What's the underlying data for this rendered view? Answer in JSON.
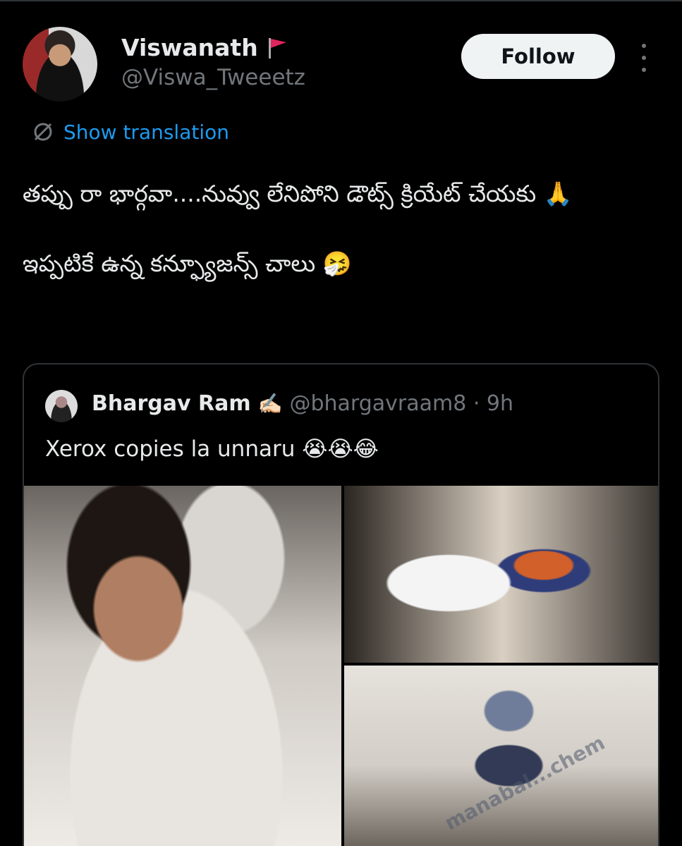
{
  "author": {
    "display_name": "Viswanath",
    "handle": "@Viswa_Tweeetz",
    "flag_emoji": "red-flag-icon"
  },
  "actions": {
    "follow_label": "Follow",
    "more_icon": "more-vertical-icon"
  },
  "translation": {
    "label": "Show translation",
    "icon": "translate-globe-icon"
  },
  "tweet": {
    "text": "తప్పు రా భార్గవా....నువ్వు లేనిపోని డౌట్స్ క్రియేట్ చేయకు 🙏\n\nఇప్పటికే ఉన్న కన్ఫ్యూజన్స్ చాలు 🤧"
  },
  "quoted_tweet": {
    "display_name": "Bhargav Ram",
    "writing_emoji": "✍🏻",
    "handle_time": "@bhargavraam8 · 9h",
    "text": "Xerox copies la unnaru 😭😭😂",
    "watermark": "manabal...chem"
  },
  "colors": {
    "background": "#000000",
    "text": "#e7e9ea",
    "muted": "#71767b",
    "link": "#1d9bf0",
    "border": "#2f3336"
  }
}
